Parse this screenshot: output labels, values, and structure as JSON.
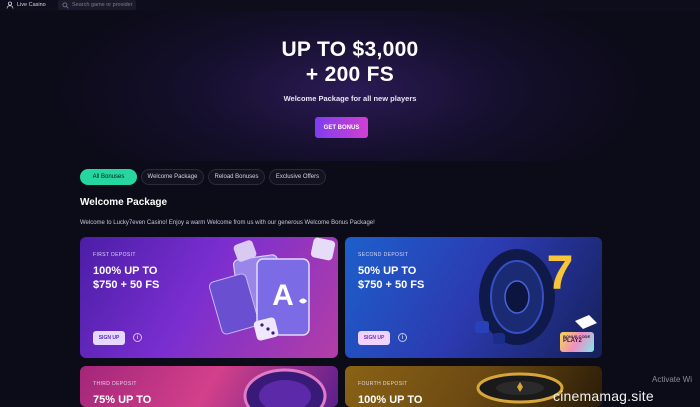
{
  "topbar": {
    "live_casino": "Live Casino",
    "search_placeholder": "Search game or provider"
  },
  "hero": {
    "title_line1": "UP TO $3,000",
    "title_line2": "+ 200 FS",
    "subtitle": "Welcome Package for all new players",
    "cta_label": "GET BONUS"
  },
  "filters": {
    "tabs": [
      "All Bonuses",
      "Welcome Package",
      "Reload Bonuses",
      "Exclusive Offers"
    ],
    "active_index": 0
  },
  "section": {
    "title": "Welcome Package",
    "description": "Welcome to Lucky7even Casino! Enjoy a warm Welcome from us with our generous Welcome Bonus Package!"
  },
  "cards": [
    {
      "label": "FIRST DEPOSIT",
      "offer_line1": "100% UP TO",
      "offer_line2": "$750 + 50 FS",
      "button": "SIGN UP",
      "info": "i"
    },
    {
      "label": "SECOND DEPOSIT",
      "offer_line1": "50% UP TO",
      "offer_line2": "$750 + 50 FS",
      "button": "SIGN UP",
      "info": "i",
      "promo_label": "BONUS CODE",
      "promo_code": "PLAY2"
    },
    {
      "label": "THIRD DEPOSIT",
      "offer_line1": "75% UP TO"
    },
    {
      "label": "FOURTH DEPOSIT",
      "offer_line1": "100% UP TO"
    }
  ],
  "overlay": {
    "activate": "Activate Wi",
    "site": "cinemamag.site"
  },
  "colors": {
    "background": "#0c0b18",
    "cta_gradient_start": "#7f3df0",
    "cta_gradient_end": "#d13fd2",
    "active_chip": "#26d6a0"
  }
}
